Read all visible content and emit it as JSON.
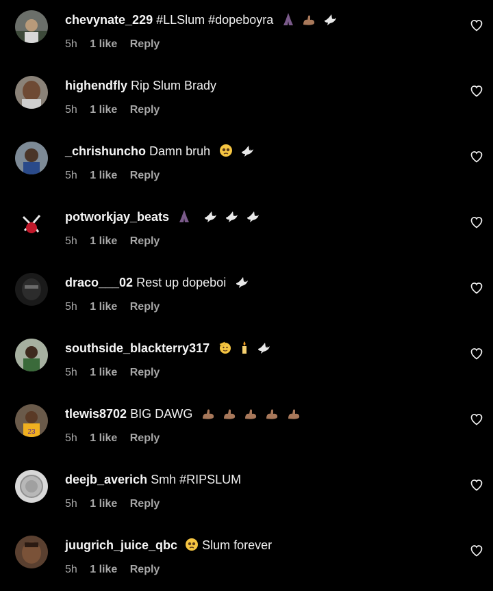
{
  "colors": {
    "background": "#000000",
    "text": "#f5f5f5",
    "meta": "#a8a8a8"
  },
  "comments": [
    {
      "username": "chevynate_229",
      "text": "#LLSlum #dopeboyra",
      "emojis": [
        "praying-hands-dark",
        "flexed-biceps",
        "dove"
      ],
      "time": "5h",
      "likes": "1 like",
      "reply": "Reply"
    },
    {
      "username": "highendfly",
      "text": "Rip Slum Brady",
      "emojis": [],
      "time": "5h",
      "likes": "1 like",
      "reply": "Reply"
    },
    {
      "username": "_chrishuncho",
      "text": "Damn bruh",
      "emojis": [
        "pleading-face",
        "dove"
      ],
      "time": "5h",
      "likes": "1 like",
      "reply": "Reply"
    },
    {
      "username": "potworkjay_beats",
      "text": "",
      "emojis": [
        "praying-hands-dark",
        "dove",
        "dove",
        "dove"
      ],
      "time": "5h",
      "likes": "1 like",
      "reply": "Reply"
    },
    {
      "username": "draco___02",
      "text": "Rest up dopeboi",
      "emojis": [
        "dove"
      ],
      "time": "5h",
      "likes": "1 like",
      "reply": "Reply"
    },
    {
      "username": "southside_blackterry317",
      "text": "",
      "emojis": [
        "saluting-face",
        "candle",
        "dove"
      ],
      "time": "5h",
      "likes": "1 like",
      "reply": "Reply"
    },
    {
      "username": "tlewis8702",
      "text": "BIG DAWG",
      "emojis": [
        "flexed-biceps",
        "flexed-biceps",
        "flexed-biceps",
        "flexed-biceps",
        "flexed-biceps"
      ],
      "time": "5h",
      "likes": "1 like",
      "reply": "Reply"
    },
    {
      "username": "deejb_averich",
      "text": "Smh #RIPSLUM",
      "emojis": [],
      "time": "5h",
      "likes": "1 like",
      "reply": "Reply"
    },
    {
      "username": "juugrich_juice_qbc",
      "text": "Slum forever",
      "emojis": [
        "pleading-face"
      ],
      "emoji_before_text": true,
      "time": "5h",
      "likes": "1 like",
      "reply": "Reply"
    }
  ]
}
